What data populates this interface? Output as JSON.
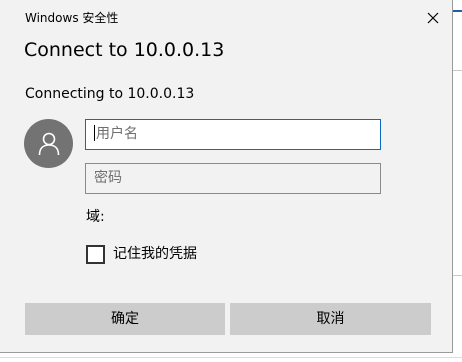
{
  "window": {
    "title": "Windows 安全性",
    "close_icon": "close-icon"
  },
  "dialog": {
    "heading": "Connect to 10.0.0.13",
    "subtext": "Connecting to 10.0.0.13"
  },
  "credentials": {
    "avatar_icon": "user-avatar-icon",
    "username": {
      "value": "",
      "placeholder": "用户名"
    },
    "password": {
      "value": "",
      "placeholder": "密码"
    },
    "domain_label": "域:",
    "remember": {
      "label": "记住我的凭据",
      "checked": false
    }
  },
  "buttons": {
    "ok_label": "确定",
    "cancel_label": "取消"
  },
  "colors": {
    "dialog_background": "#f2f2f2",
    "focus_border": "#0a6bc7",
    "button_background": "#cccccc",
    "avatar_background": "#737373"
  }
}
